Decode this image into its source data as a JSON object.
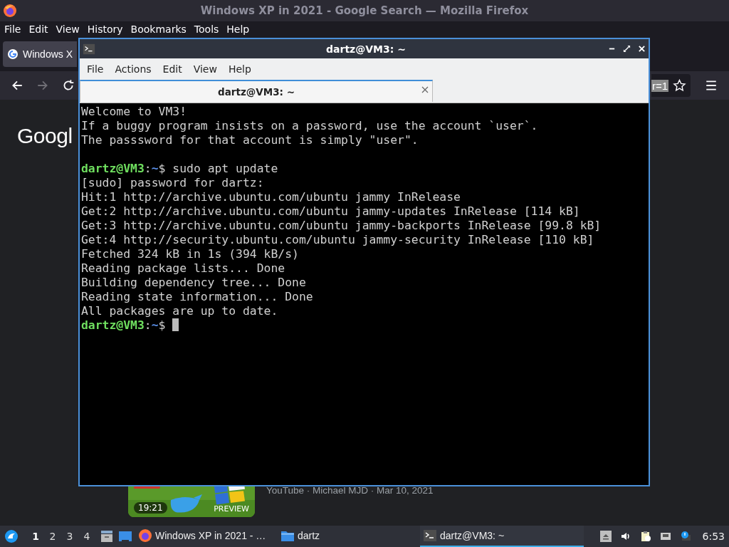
{
  "firefox": {
    "title": "Windows XP in 2021 - Google Search — Mozilla Firefox",
    "menu": [
      "File",
      "Edit",
      "View",
      "History",
      "Bookmarks",
      "Tools",
      "Help"
    ],
    "tab": {
      "title": "Windows X"
    },
    "url_text": "r=1",
    "logo": "Googl",
    "video": {
      "duration": "19:21",
      "badge": "PREVIEW",
      "meta": "YouTube · Michael MJD · Mar 10, 2021"
    }
  },
  "terminal": {
    "title": "dartz@VM3: ~",
    "menu": [
      "File",
      "Actions",
      "Edit",
      "View",
      "Help"
    ],
    "tab": {
      "title": "dartz@VM3: ~"
    },
    "lines": [
      {
        "kind": "text",
        "text": "Welcome to VM3!"
      },
      {
        "kind": "text",
        "text": "If a buggy program insists on a password, use the account `user`."
      },
      {
        "kind": "text",
        "text": "The passsword for that account is simply \"user\"."
      },
      {
        "kind": "blank"
      },
      {
        "kind": "prompt",
        "user": "dartz@VM3",
        "sep": ":",
        "path": "~",
        "symbol": "$",
        "command": "sudo apt update"
      },
      {
        "kind": "text",
        "text": "[sudo] password for dartz:"
      },
      {
        "kind": "text",
        "text": "Hit:1 http://archive.ubuntu.com/ubuntu jammy InRelease"
      },
      {
        "kind": "text",
        "text": "Get:2 http://archive.ubuntu.com/ubuntu jammy-updates InRelease [114 kB]"
      },
      {
        "kind": "text",
        "text": "Get:3 http://archive.ubuntu.com/ubuntu jammy-backports InRelease [99.8 kB]"
      },
      {
        "kind": "text",
        "text": "Get:4 http://security.ubuntu.com/ubuntu jammy-security InRelease [110 kB]"
      },
      {
        "kind": "text",
        "text": "Fetched 324 kB in 1s (394 kB/s)"
      },
      {
        "kind": "text",
        "text": "Reading package lists... Done"
      },
      {
        "kind": "text",
        "text": "Building dependency tree... Done"
      },
      {
        "kind": "text",
        "text": "Reading state information... Done"
      },
      {
        "kind": "text",
        "text": "All packages are up to date."
      },
      {
        "kind": "prompt",
        "user": "dartz@VM3",
        "sep": ":",
        "path": "~",
        "symbol": "$",
        "cursor": true
      }
    ]
  },
  "taskbar": {
    "workspaces": [
      {
        "label": "1",
        "selected": true
      },
      {
        "label": "2",
        "selected": false
      },
      {
        "label": "3",
        "selected": false
      },
      {
        "label": "4",
        "selected": false
      }
    ],
    "tasks": [
      {
        "kind": "browser",
        "label": "Windows XP in 2021 - …",
        "selected": false
      },
      {
        "kind": "folder",
        "label": "dartz",
        "selected": false
      },
      {
        "kind": "terminal",
        "label": "dartz@VM3: ~",
        "selected": true
      }
    ],
    "clock": "6:53"
  }
}
